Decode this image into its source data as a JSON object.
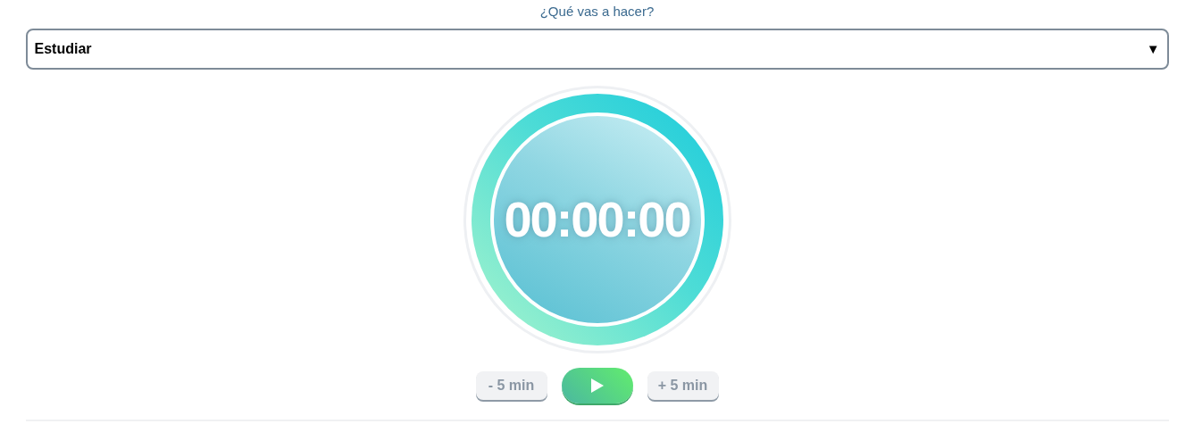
{
  "activity": {
    "label": "¿Qué vas a hacer?",
    "value": "Estudiar",
    "arrow": "▼"
  },
  "timer": {
    "time": "00:00:00"
  },
  "controls": {
    "minus": "- 5 min",
    "plus": "+ 5 min"
  }
}
